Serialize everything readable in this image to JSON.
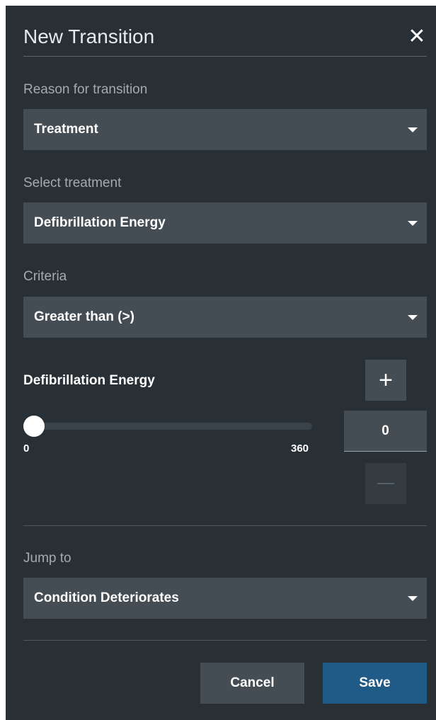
{
  "dialog": {
    "title": "New Transition",
    "close_glyph": "✕"
  },
  "reason": {
    "label": "Reason for transition",
    "value": "Treatment"
  },
  "treatment": {
    "label": "Select treatment",
    "value": "Defibrillation Energy"
  },
  "criteria": {
    "label": "Criteria",
    "value": "Greater than (>)"
  },
  "energy": {
    "label": "Defibrillation Energy",
    "min_label": "0",
    "max_label": "360",
    "min": 0,
    "max": 360,
    "value": 0,
    "value_text": "0",
    "plus_glyph": "+"
  },
  "jump": {
    "label": "Jump to",
    "value": "Condition Deteriorates"
  },
  "footer": {
    "cancel_label": "Cancel",
    "save_label": "Save"
  },
  "colors": {
    "panel": "#282f35",
    "field": "#444d53",
    "primary": "#1f5b86"
  }
}
